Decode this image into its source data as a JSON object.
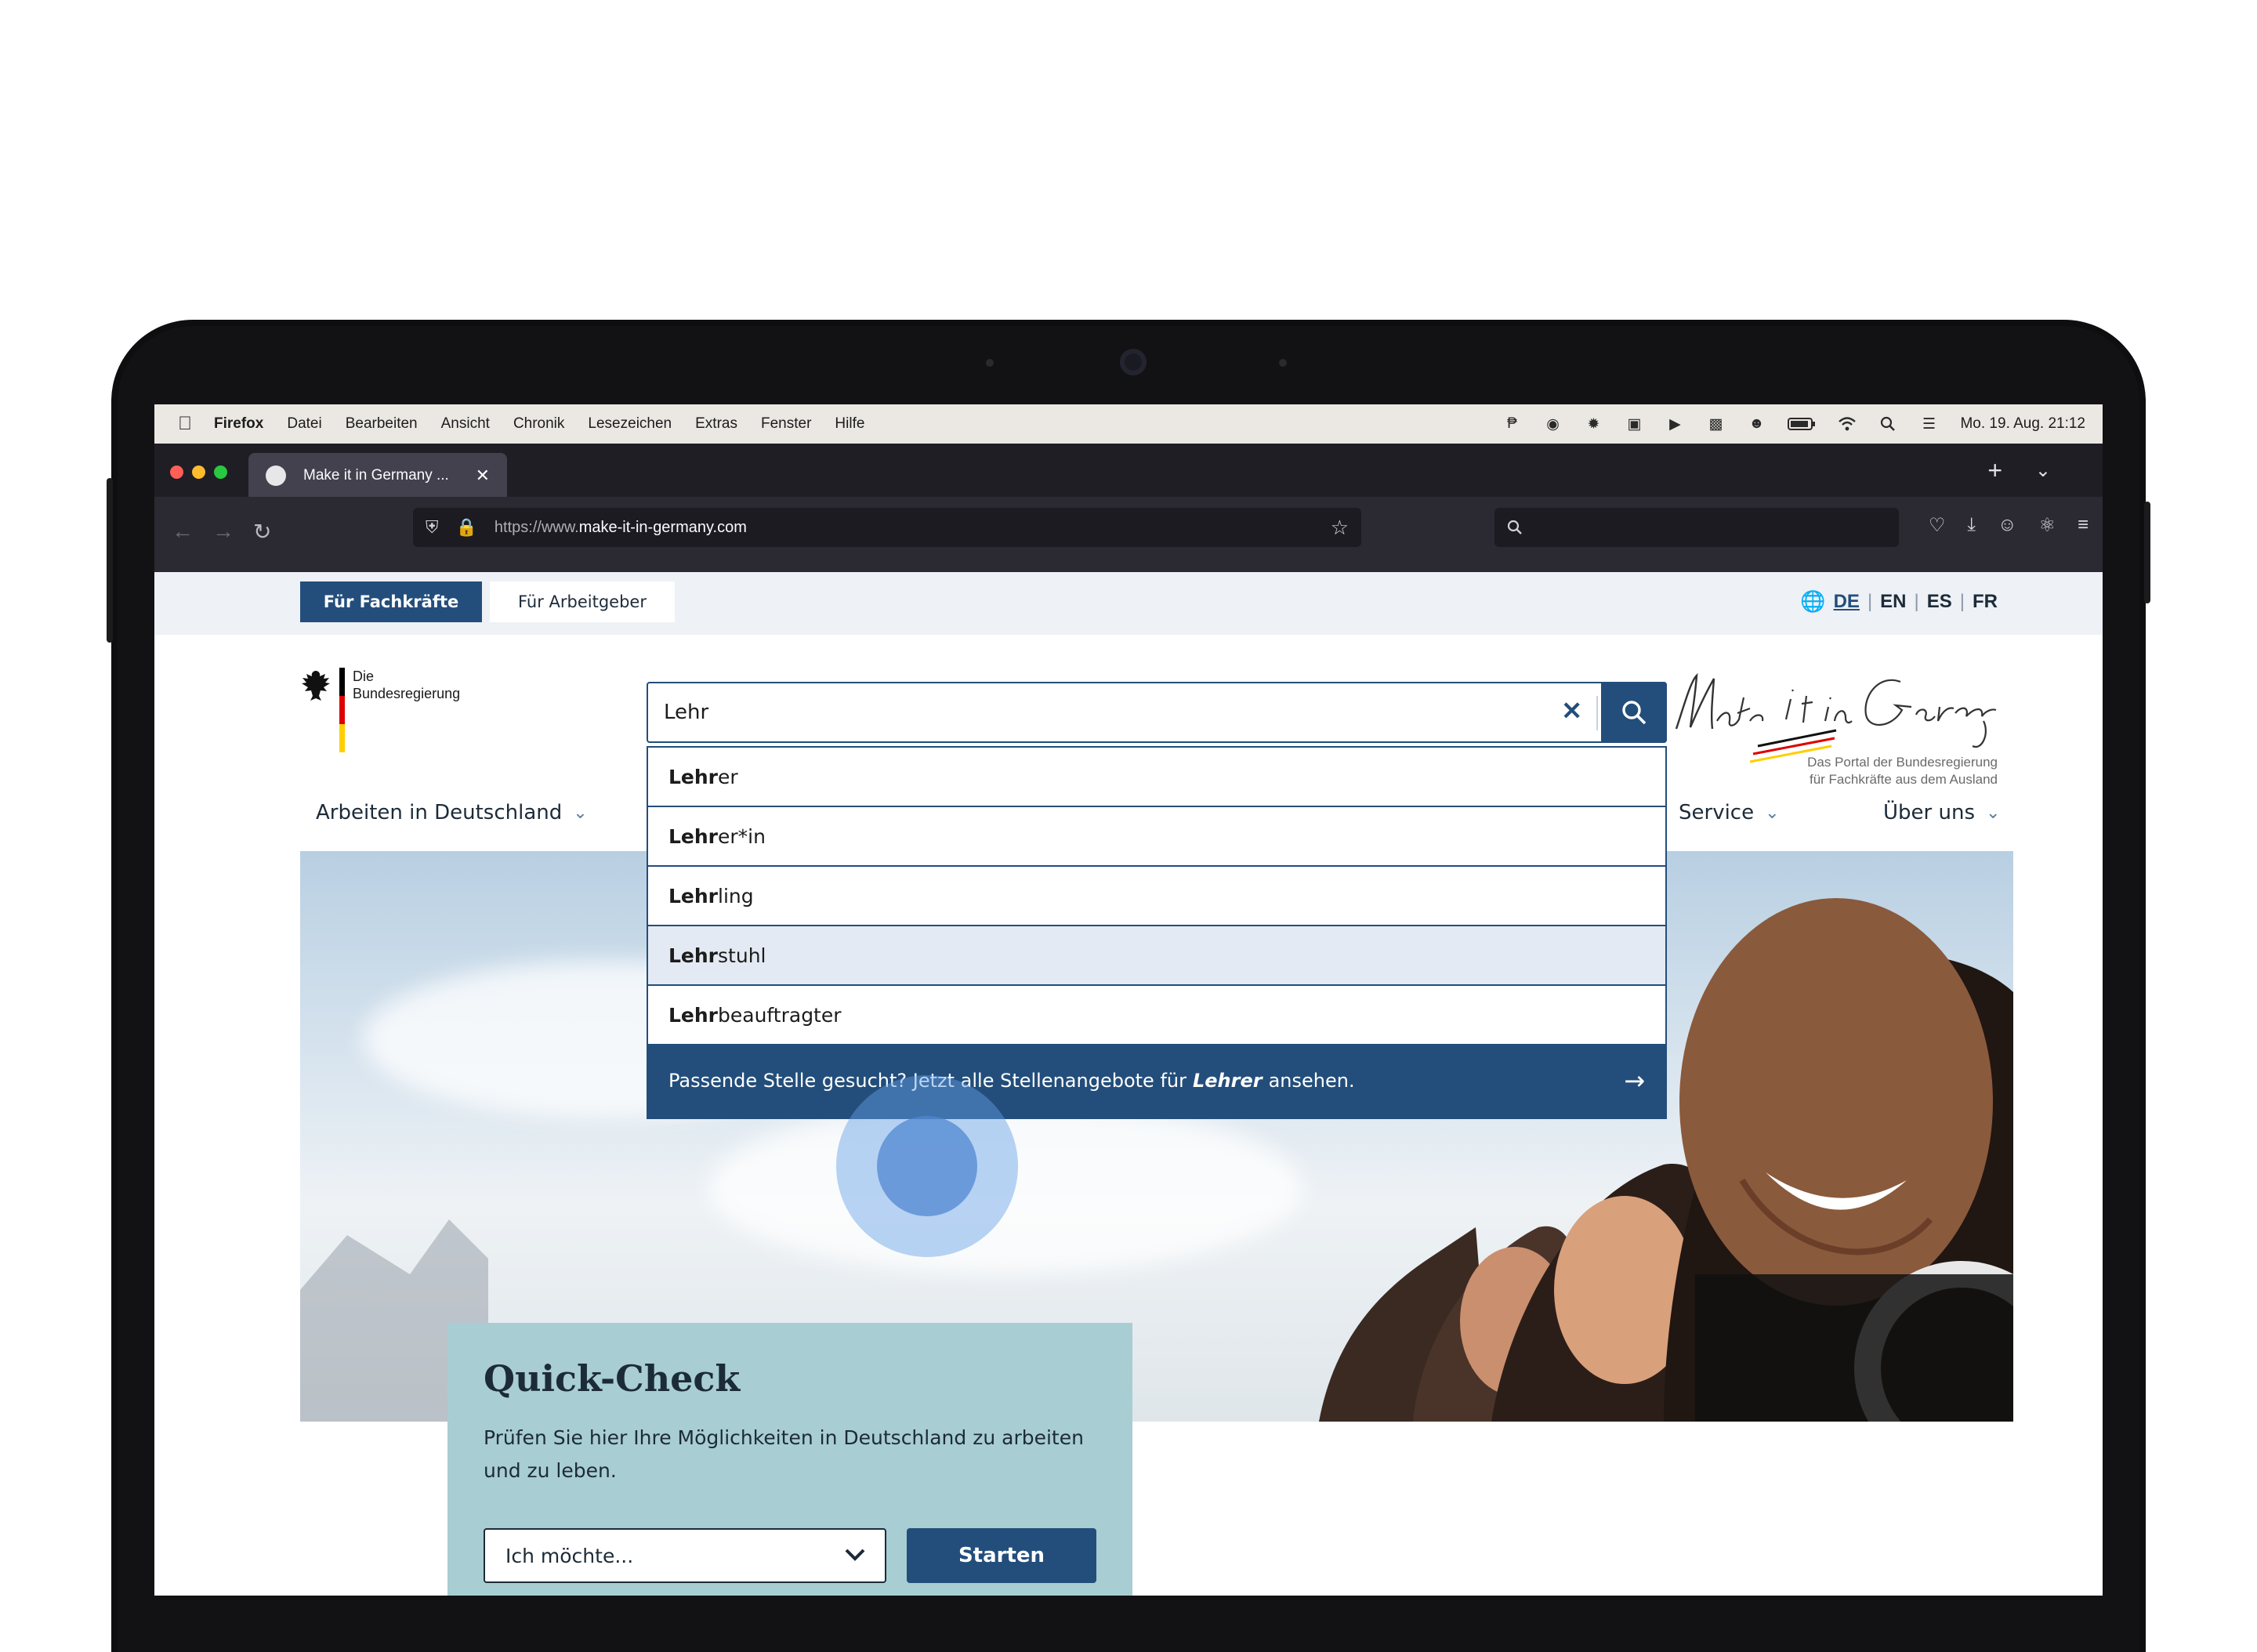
{
  "menubar": {
    "app": "Firefox",
    "items": [
      "Datei",
      "Bearbeiten",
      "Ansicht",
      "Chronik",
      "Lesezeichen",
      "Extras",
      "Fenster",
      "Hilfe"
    ],
    "clock": "Mo. 19. Aug.  21:12"
  },
  "browser": {
    "tab_title": "Make it in Germany ...",
    "url_prefix": "https://www.",
    "url_domain": "make-it-in-germany.com"
  },
  "audience": {
    "active": "Für Fachkräfte",
    "inactive": "Für Arbeitgeber"
  },
  "languages": {
    "current": "DE",
    "others": [
      "EN",
      "ES",
      "FR"
    ]
  },
  "logo": {
    "line1": "Die",
    "line2": "Bundesregierung",
    "tagline_line1": "Das Portal der Bundesregierung",
    "tagline_line2": "für Fachkräfte aus dem Ausland",
    "brand_script": "Make it in Germany"
  },
  "nav": {
    "item1": "Arbeiten in Deutschland",
    "item2": "Service",
    "item3": "Über uns"
  },
  "search": {
    "query": "Lehr",
    "suggestions": [
      {
        "bold": "Lehr",
        "rest": "er"
      },
      {
        "bold": "Lehr",
        "rest": "er*in"
      },
      {
        "bold": "Lehr",
        "rest": "ling"
      },
      {
        "bold": "Lehr",
        "rest": "stuhl"
      },
      {
        "bold": "Lehr",
        "rest": "beauftragter"
      }
    ],
    "footer_before": "Passende Stelle gesucht? Jetzt alle Stellenangebote für",
    "footer_term": "Lehrer",
    "footer_after": "ansehen."
  },
  "quickcheck": {
    "title": "Quick-Check",
    "text": "Prüfen Sie hier Ihre Möglichkeiten in Deutschland zu arbeiten und zu leben.",
    "select_placeholder": "Ich möchte...",
    "start_label": "Starten"
  },
  "colors": {
    "brand": "#234e7b",
    "quickcheck_bg": "#a8cdd2"
  }
}
